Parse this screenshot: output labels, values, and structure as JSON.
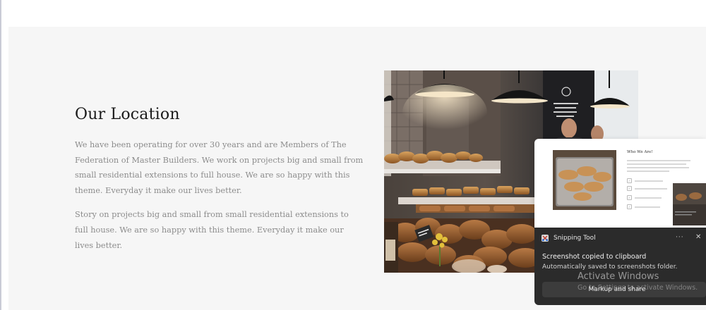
{
  "location": {
    "heading": "Our Location",
    "paragraphs": [
      "We have been operating for over 30 years and are Members of The Federation of Master Builders. We work on projects big and small from small residential extensions to full house. We are so happy with this theme. Everyday it make our lives better.",
      "Story on projects big and small from small residential extensions to full house. We are so happy with this theme. Everyday it make our lives better."
    ]
  },
  "preview": {
    "heading": "Who We Are!"
  },
  "toast": {
    "app_name": "Snipping Tool",
    "more_label": "···",
    "close_label": "✕",
    "title": "Screenshot copied to clipboard",
    "body": "Automatically saved to screenshots folder.",
    "button_label": "Markup and share"
  },
  "watermark": {
    "title": "Activate Windows",
    "subtitle": "Go to Settings to activate Windows."
  },
  "colors": {
    "section_bg": "#f6f6f6",
    "heading": "#1b1b1b",
    "body_text": "#8c8c8c",
    "toast_bg": "#2b2b2b"
  }
}
